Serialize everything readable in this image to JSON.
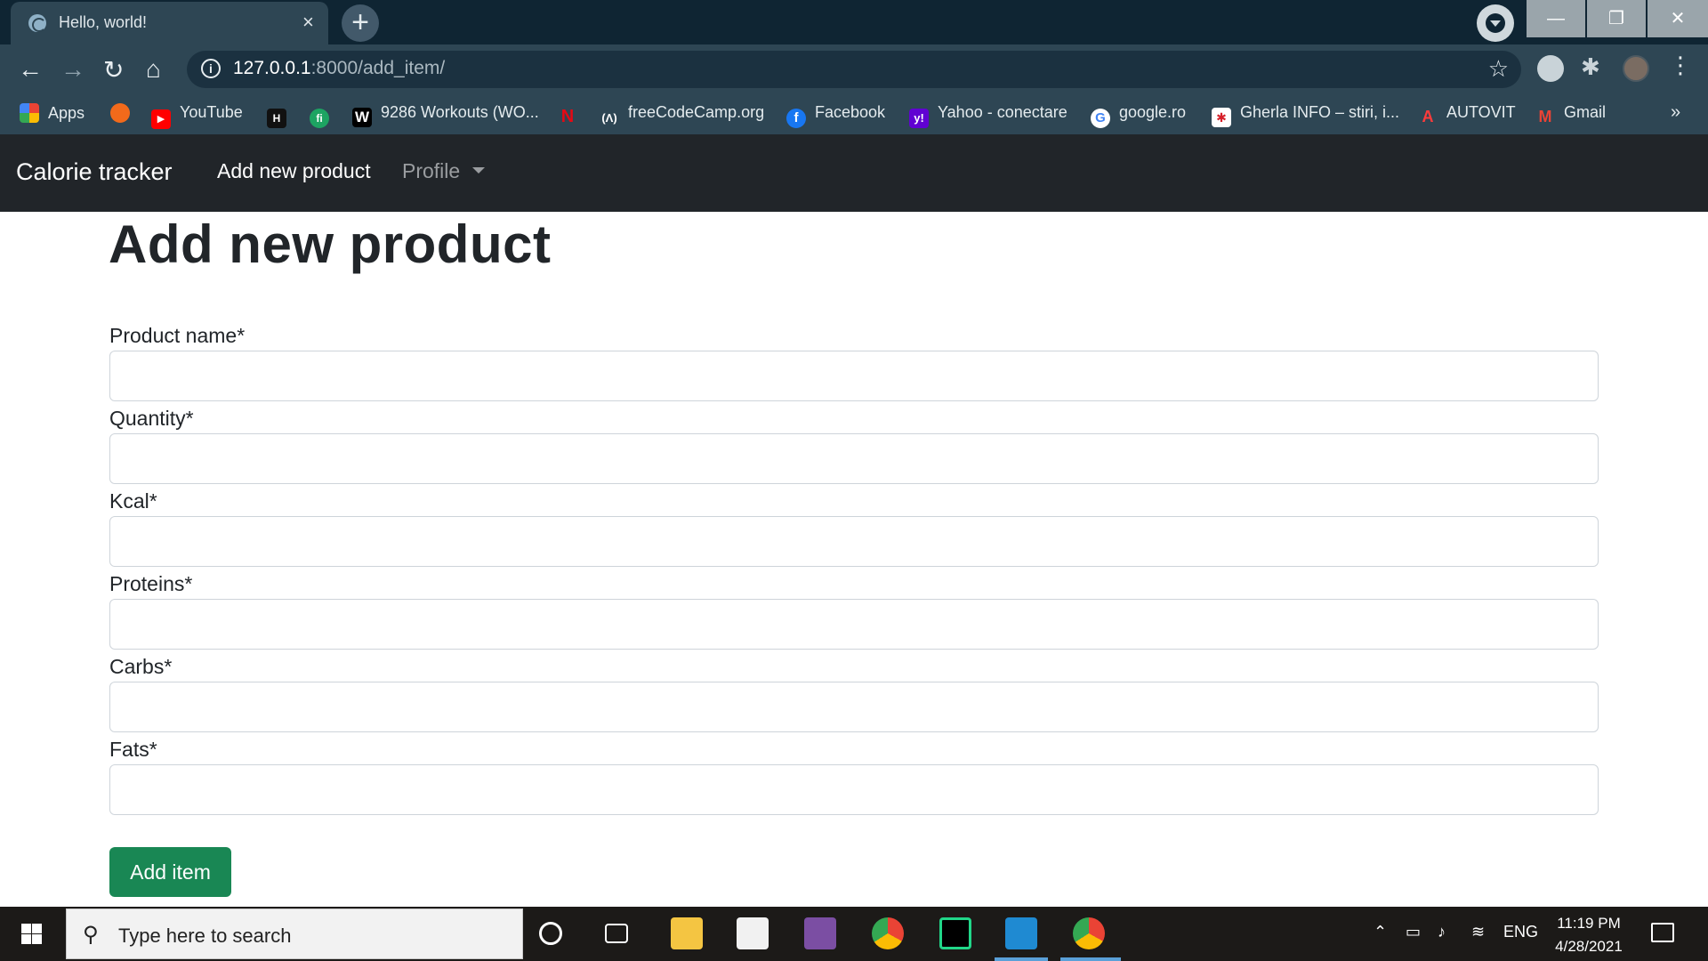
{
  "browser": {
    "tab_title": "Hello, world!",
    "tab_close": "×",
    "new_tab": "+",
    "window_buttons": {
      "minimize": "—",
      "maximize": "❐",
      "close": "✕"
    },
    "nav": {
      "back": "←",
      "forward": "→",
      "reload": "↻",
      "home": "⌂"
    },
    "url_host": "127.0.0.1",
    "url_path": ":8000/add_item/",
    "star": "☆",
    "menu": "⋮",
    "puzzle": "✱",
    "bookmarks": [
      {
        "label": "Apps",
        "icon": "apps-grid-icon",
        "color": "#e8453c"
      },
      {
        "label": "",
        "icon": "orange-c-icon",
        "color": "#f26a1b"
      },
      {
        "label": "YouTube",
        "icon": "youtube-icon",
        "color": "#ff0000"
      },
      {
        "label": "",
        "icon": "hackerrank-icon",
        "color": "#111111"
      },
      {
        "label": "",
        "icon": "fi-icon",
        "color": "#1da462"
      },
      {
        "label": "9286 Workouts (WO...",
        "icon": "w-icon",
        "color": "#000000"
      },
      {
        "label": "",
        "icon": "netflix-icon",
        "color": "#e50914"
      },
      {
        "label": "freeCodeCamp.org",
        "icon": "freecodecamp-icon",
        "color": "#0a0a23"
      },
      {
        "label": "Facebook",
        "icon": "facebook-icon",
        "color": "#1877f2"
      },
      {
        "label": "Yahoo - conectare",
        "icon": "yahoo-icon",
        "color": "#6001d2"
      },
      {
        "label": "google.ro",
        "icon": "google-icon",
        "color": "#ffffff"
      },
      {
        "label": "Gherla INFO – stiri, i...",
        "icon": "gherla-icon",
        "color": "#d6202a"
      },
      {
        "label": "AUTOVIT",
        "icon": "autovit-icon",
        "color": "#d6202a"
      },
      {
        "label": "Gmail",
        "icon": "gmail-icon",
        "color": "#ea4335"
      }
    ],
    "bookmarks_more": "»"
  },
  "app": {
    "brand": "Calorie tracker",
    "nav_add": "Add new product",
    "nav_profile": "Profile"
  },
  "form": {
    "title": "Add new product",
    "fields": [
      {
        "label": "Product name*",
        "value": ""
      },
      {
        "label": "Quantity*",
        "value": ""
      },
      {
        "label": "Kcal*",
        "value": ""
      },
      {
        "label": "Proteins*",
        "value": ""
      },
      {
        "label": "Carbs*",
        "value": ""
      },
      {
        "label": "Fats*",
        "value": ""
      }
    ],
    "submit_label": "Add item"
  },
  "taskbar": {
    "search_placeholder": "Type here to search",
    "language": "ENG",
    "time": "11:19 PM",
    "date": "4/28/2021",
    "apps": [
      "cortana-icon",
      "task-view-icon",
      "file-explorer-icon",
      "store-icon",
      "screenshot-tool-icon",
      "chrome-icon",
      "pycharm-icon",
      "vscode-icon",
      "chrome-active-icon"
    ]
  },
  "colors": {
    "navbar_bg": "#212529",
    "button_green": "#198754",
    "browser_frame": "#0f2533",
    "browser_toolbar": "#2e4654"
  }
}
